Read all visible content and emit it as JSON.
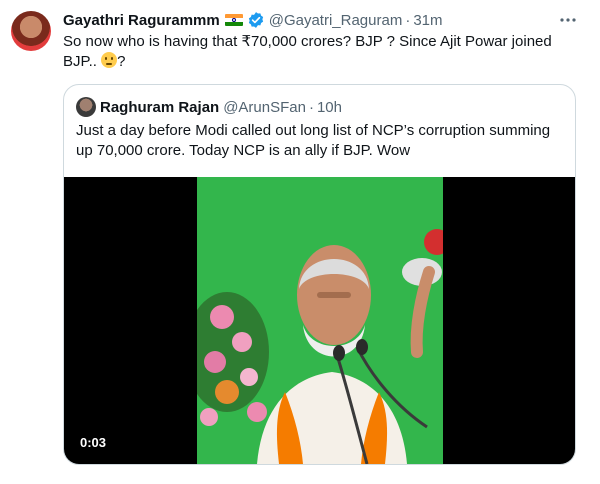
{
  "tweet": {
    "author": {
      "name": "Gayathri Ragurammm",
      "handle": "@Gayatri_Raguram",
      "time": "31m"
    },
    "icons": {
      "flag": "india-flag-icon",
      "verified": "verified-badge-icon",
      "more": "more-options-icon"
    },
    "text": "So now who is having that ₹70,000 crores? BJP ? Since Ajit Powar joined BJP.. ",
    "text_end": "?",
    "emoji": "thinking-face-emoji"
  },
  "quoted_tweet": {
    "author": {
      "name": "Raghuram Rajan",
      "handle": "@ArunSFan",
      "time": "10h"
    },
    "text": "Just a day before Modi called out long list of NCP’s corruption summing up 70,000 crore. Today NCP is an ally if BJP. Wow",
    "video": {
      "duration": "0:03"
    }
  },
  "colors": {
    "text": "#0f1419",
    "secondary": "#536471",
    "border": "#cfd9de",
    "verified": "#1d9bf0",
    "video_bg": "#000000",
    "backdrop": "#30b84a"
  }
}
